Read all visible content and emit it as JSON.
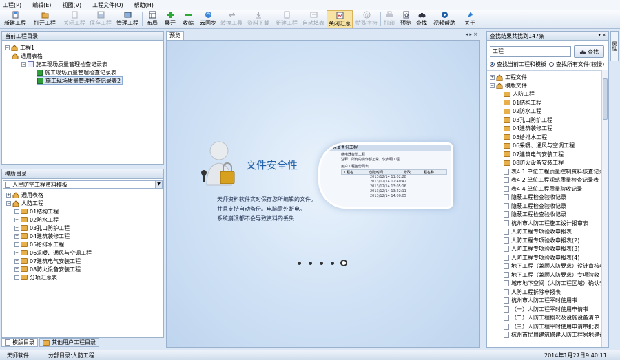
{
  "menu": [
    "工程(P)",
    "编辑(E)",
    "视图(V)",
    "工程文件(O)",
    "帮助(H)"
  ],
  "toolbar": {
    "new_project": "新建工程",
    "open_project": "打开工程",
    "close_project": "关闭工程",
    "save_project": "保存工程",
    "manage_project": "管理工程",
    "layout": "布局",
    "expand": "展开",
    "collapse": "收缩",
    "cloud_sync": "云同步",
    "convert_tool": "转换工具",
    "download": "资料下载",
    "new_project2": "新建工程",
    "auto_fill": "自动填表",
    "close_summary": "关闭汇总",
    "special_char": "特殊字符",
    "print": "打印",
    "preview": "预览",
    "find": "查找",
    "video_help": "视频帮助",
    "about": "关于"
  },
  "project_panel": {
    "title": "当前工程目录",
    "items": [
      "工程1",
      "通用表格",
      "施工现场质量管理检查记录表",
      "施工现场质量管理检查记录表",
      "施工现场质量管理检查记录表2"
    ]
  },
  "template_panel": {
    "title": "模版目录",
    "select_value": "人民防空工程资料模板",
    "items": [
      "通用表格",
      "人防工程",
      "01结构工程",
      "02防水工程",
      "03孔口防护工程",
      "04建筑装修工程",
      "05给排水工程",
      "06采暖、通风与空调工程",
      "07建筑电气安装工程",
      "08防火设备安装工程",
      "分项汇总表"
    ],
    "tabs": [
      "模版目录",
      "其他用户工程目录"
    ]
  },
  "center": {
    "tab": "预览",
    "title": "文件安全性",
    "lines": [
      "天师资料软件实时保存您所编辑的文件。",
      "并且支持自动备份。电脑意外断电。",
      "系统崩溃都不会导致资料的丢失"
    ],
    "shot_title": "恢复备份工程",
    "shot_lines": [
      "继电器备份工程",
      "注释：所有的操作都正常，仅表明工程..."
    ],
    "shot_headers": [
      "工程名",
      "创建时间",
      "修改",
      "工程名称"
    ],
    "shot_rows": [
      "2013/12/14 11:02:28",
      "2013/12/14 12:40:42",
      "2013/12/14 13:05:16",
      "2013/12/14 13:22:11",
      "2013/12/14 14:00:05"
    ],
    "shot_list": "用户工程备份列表"
  },
  "search_panel": {
    "title": "查找结果共找到147条",
    "query": "工程",
    "search_btn": "查找",
    "opt1": "查找当前工程和模板",
    "opt2": "查找所有文件(较慢)",
    "side_tab": "属性",
    "items": [
      "工程文件",
      "模版文件",
      "人防工程",
      "01结构工程",
      "02防水工程",
      "03孔口防护工程",
      "04建筑装修工程",
      "05给排水工程",
      "06采暖、通风与空调工程",
      "07建筑电气安装工程",
      "08防火设备安装工程",
      "表4.1  单位工程质量控制资料核查记录",
      "表4.2  单位工程观感质量检查记录表",
      "表4.4  单位工程质量验收记录",
      "隐蔽工程检查验收记录",
      "隐蔽工程检查验收记录",
      "隐蔽工程检查验收记录",
      "杭州市人防工程施工设计报审表",
      "人防工程专项验收申报表",
      "人防工程专项验收申报表(2)",
      "人防工程专项验收申报表(3)",
      "人防工程专项验收申报表(4)",
      "地下工程（兼顾人防要求）设计审核表",
      "地下工程（兼顾人防要求）专项验收",
      "城市地下空间（人防工程区域）确认表",
      "人防工程拆除申报表",
      "杭州市人防工程平时使用书",
      "（一）人防工程平时使用申请书",
      "（二）人防工程概况及设施设备清单",
      "（三）人防工程平时使用申请审批表",
      "杭州市民用建筑修建人防工程易地建设"
    ]
  },
  "status": {
    "app": "天师软件",
    "path": "分部目录:人防工程",
    "date": "2014年1月27日",
    "time": "9:40:11"
  },
  "colors": {
    "accent": "#1e5fa8",
    "panel_border": "#9bb2cf",
    "center_bg": "#c7dcf3"
  }
}
